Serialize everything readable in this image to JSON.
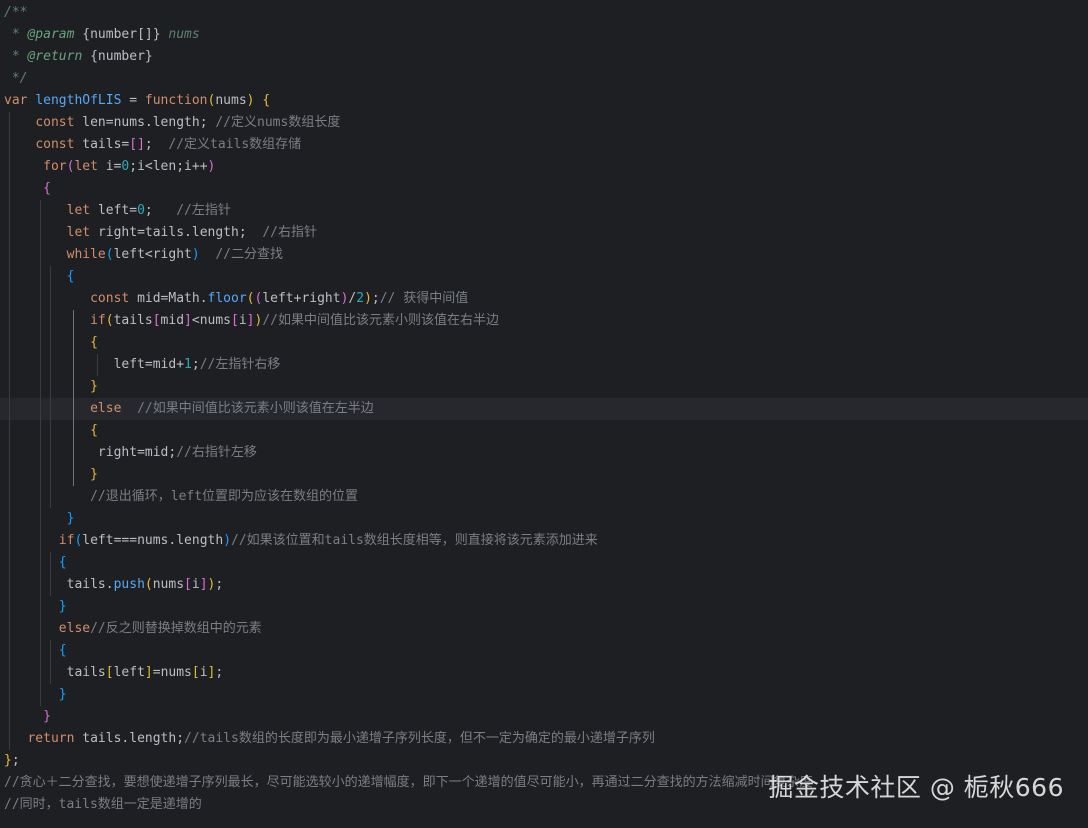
{
  "editor": {
    "lines": [
      "/**",
      " * @param {number[]} nums",
      " * @return {number}",
      " */",
      "var lengthOfLIS = function(nums) {",
      "    const len=nums.length; //定义nums数组长度",
      "    const tails=[];  //定义tails数组存储",
      "     for(let i=0;i<len;i++)",
      "     {",
      "        let left=0;   //左指针",
      "        let right=tails.length;  //右指针",
      "        while(left<right)  //二分查找",
      "        {",
      "           const mid=Math.floor((left+right)/2);// 获得中间值",
      "           if(tails[mid]<nums[i])//如果中间值比该元素小则该值在右半边",
      "           {",
      "              left=mid+1;//左指针右移",
      "           }",
      "           else  //如果中间值比该元素小则该值在左半边",
      "           {",
      "            right=mid;//右指针左移",
      "           }",
      "           //退出循环，left位置即为应该在数组的位置",
      "        }",
      "       if(left===nums.length)//如果该位置和tails数组长度相等，则直接将该元素添加进来",
      "       {",
      "        tails.push(nums[i]);",
      "       }",
      "       else//反之则替换掉数组中的元素",
      "       {",
      "        tails[left]=nums[i];",
      "       }",
      "     }",
      "   return tails.length;//tails数组的长度即为最小递增子序列长度，但不一定为确定的最小递增子序列",
      "};",
      "//贪心＋二分查找，要想使递增子序列最长，尽可能选较小的递增幅度，即下一个递增的值尽可能小，再通过二分查找的方法缩减时间复杂度",
      "//同时，tails数组一定是递增的"
    ],
    "current_line": 18
  },
  "watermark": "掘金技术社区 @ 栀秋666",
  "colors": {
    "background": "#1e1f22",
    "current_line": "#26282e",
    "keyword": "#cf8e6d",
    "function": "#56a8f5",
    "number": "#2aacb8",
    "comment": "#7a7e85",
    "brace_yellow": "#e8ba36",
    "brace_purple": "#d670d6",
    "brace_blue": "#179fff"
  }
}
